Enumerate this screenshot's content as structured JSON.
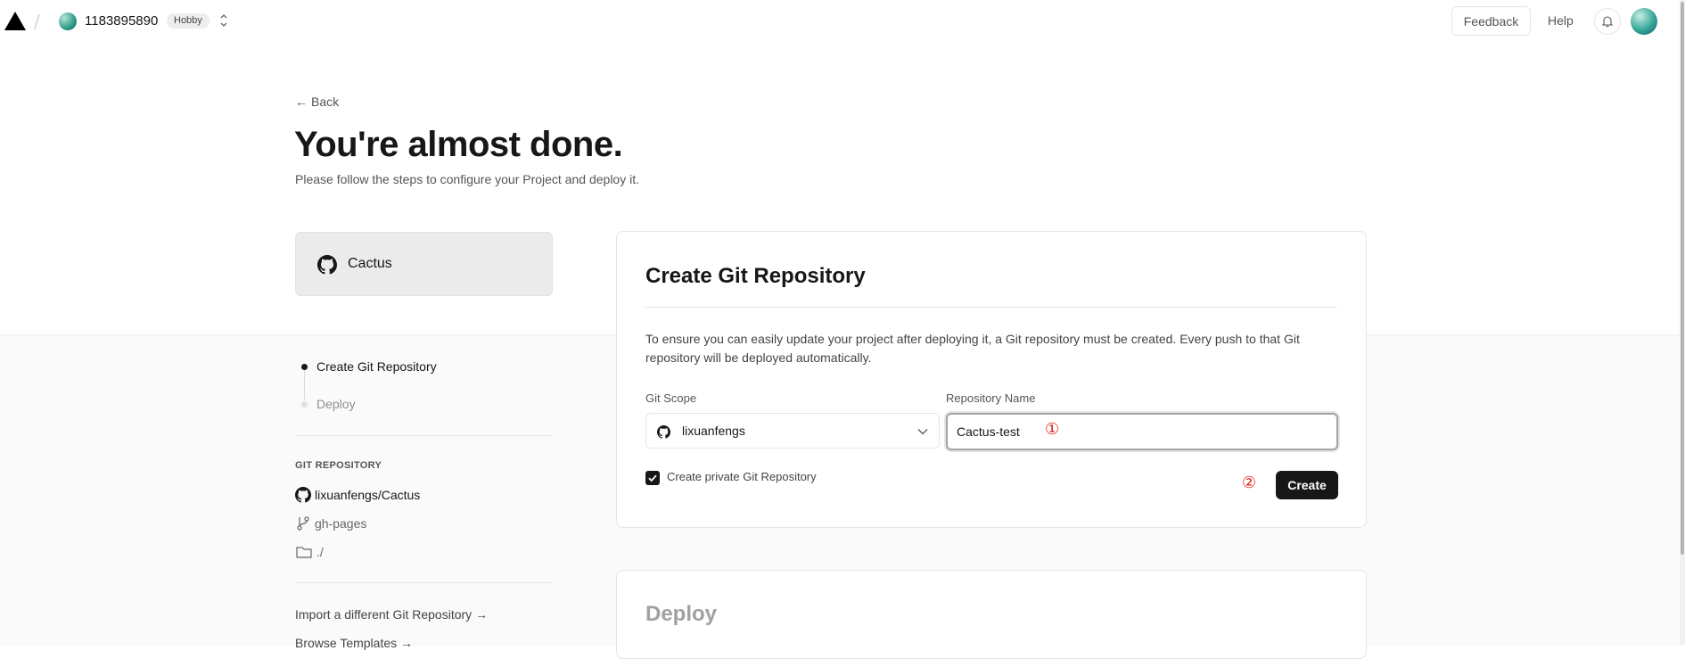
{
  "topbar": {
    "team_name": "1183895890",
    "plan_badge": "Hobby",
    "feedback_label": "Feedback",
    "help_label": "Help"
  },
  "header": {
    "back_label": "Back",
    "title": "You're almost done.",
    "subtitle": "Please follow the steps to configure your Project and deploy it."
  },
  "repo_card": {
    "name": "Cactus"
  },
  "steps": [
    {
      "label": "Create Git Repository",
      "active": true
    },
    {
      "label": "Deploy",
      "active": false
    }
  ],
  "git_repository": {
    "heading": "GIT REPOSITORY",
    "repo": "lixuanfengs/Cactus",
    "branch": "gh-pages",
    "directory": "./"
  },
  "side_links": {
    "import_label": "Import a different Git Repository →",
    "templates_label": "Browse Templates →"
  },
  "create_card": {
    "title": "Create Git Repository",
    "description": "To ensure you can easily update your project after deploying it, a Git repository must be created. Every push to that Git repository will be deployed automatically.",
    "git_scope_label": "Git Scope",
    "git_scope_value": "lixuanfengs",
    "repo_name_label": "Repository Name",
    "repo_name_value": "Cactus-test",
    "private_checkbox_label": "Create private Git Repository",
    "private_checked": true,
    "create_label": "Create",
    "annotation_1": "①",
    "annotation_2": "②"
  },
  "deploy_card": {
    "title": "Deploy"
  },
  "colors": {
    "accent": "#171717",
    "annotation": "#e0201a",
    "muted": "#a1a1a1"
  }
}
